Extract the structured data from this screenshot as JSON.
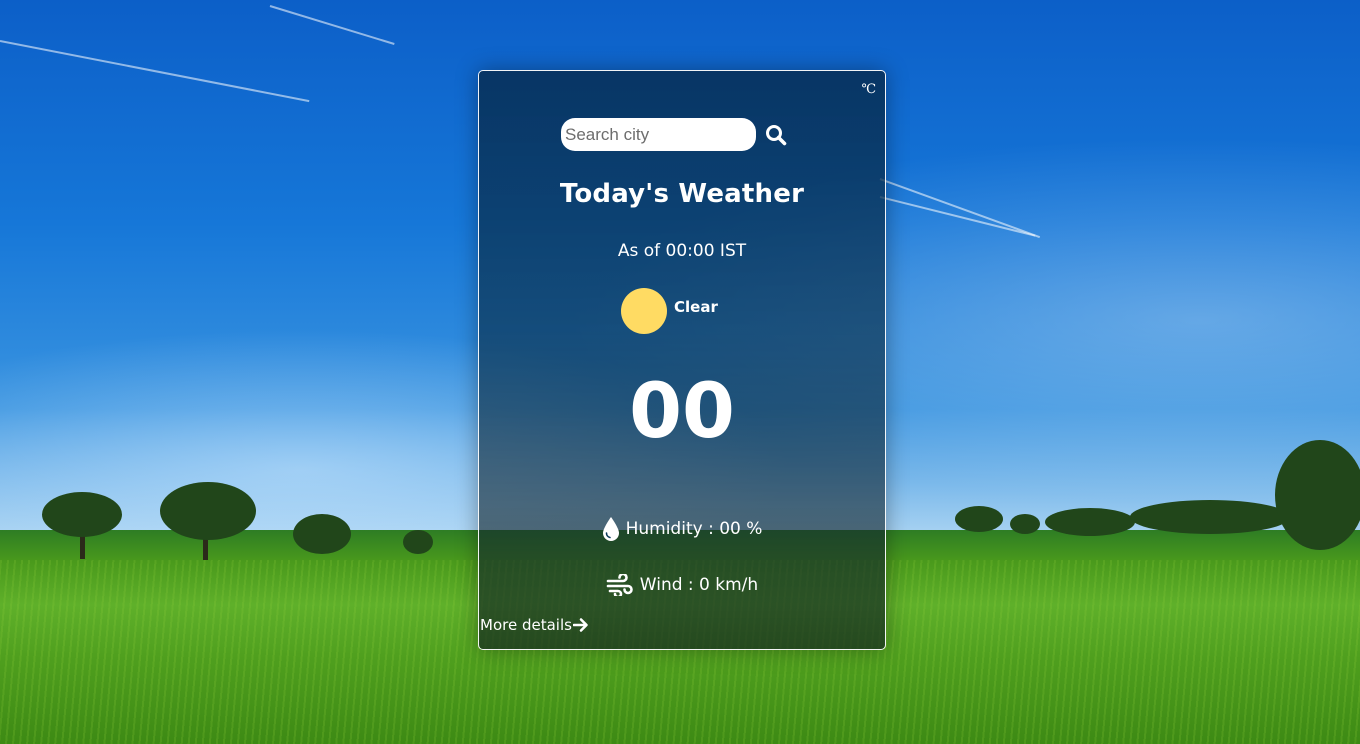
{
  "card": {
    "unit_toggle": "℃",
    "search": {
      "placeholder": "Search city",
      "value": ""
    },
    "title": "Today's Weather",
    "as_of": "As of 00:00 IST",
    "condition": {
      "label": "Clear",
      "icon": "sun-icon",
      "icon_color": "#ffdb63"
    },
    "temperature": "00",
    "humidity": {
      "label": "Humidity : 00 %",
      "icon": "water-drop-icon"
    },
    "wind": {
      "label": "Wind : 0 km/h",
      "icon": "wind-icon"
    },
    "more_details": {
      "label": "More details",
      "icon": "arrow-right-icon"
    }
  }
}
